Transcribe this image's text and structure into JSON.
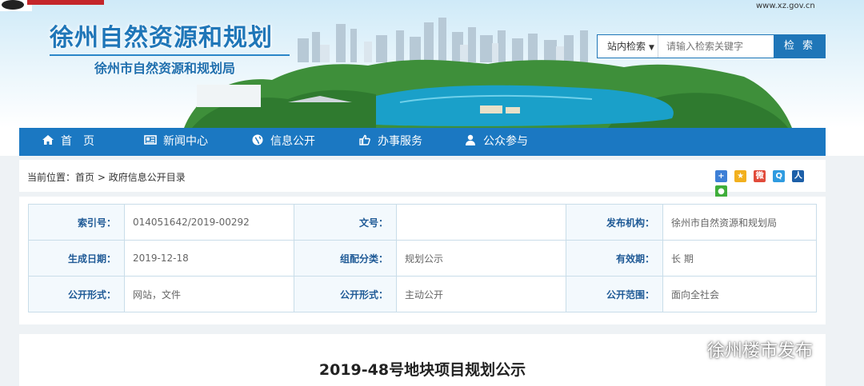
{
  "header": {
    "title": "徐州自然资源和规划",
    "subtitle": "徐州市自然资源和规划局",
    "gov_url": "www.xz.gov.cn"
  },
  "search": {
    "scope": "站内检索",
    "placeholder": "请输入检索关键字",
    "button": "检 索"
  },
  "nav": [
    {
      "label": "首　页",
      "icon": "home-icon"
    },
    {
      "label": "新闻中心",
      "icon": "newspaper-icon"
    },
    {
      "label": "信息公开",
      "icon": "globe-icon"
    },
    {
      "label": "办事服务",
      "icon": "thumbs-up-icon"
    },
    {
      "label": "公众参与",
      "icon": "user-icon"
    }
  ],
  "breadcrumb": {
    "prefix": "当前位置：",
    "home": "首页",
    "sep": " > ",
    "current": "政府信息公开目录"
  },
  "share_icons": [
    "plus-share-icon",
    "star-share-icon",
    "weibo-share-icon",
    "qzone-share-icon",
    "renren-share-icon",
    "wechat-share-icon"
  ],
  "meta": {
    "rows": [
      [
        {
          "label": "索引号：",
          "value": "014051642/2019-00292"
        },
        {
          "label": "文号：",
          "value": ""
        },
        {
          "label": "发布机构：",
          "value": "徐州市自然资源和规划局"
        }
      ],
      [
        {
          "label": "生成日期：",
          "value": "2019-12-18"
        },
        {
          "label": "组配分类：",
          "value": "规划公示"
        },
        {
          "label": "有效期：",
          "value": "长 期"
        }
      ],
      [
        {
          "label": "公开形式：",
          "value": "网站，文件"
        },
        {
          "label": "公开形式：",
          "value": "主动公开"
        },
        {
          "label": "公开范围：",
          "value": "面向全社会"
        }
      ]
    ]
  },
  "article": {
    "title": "2019-48号地块项目规划公示"
  },
  "watermark": "徐州楼市发布",
  "colors": {
    "brand_blue": "#1b78c2",
    "label_blue": "#1f5a96",
    "table_border": "#c9dde9"
  }
}
